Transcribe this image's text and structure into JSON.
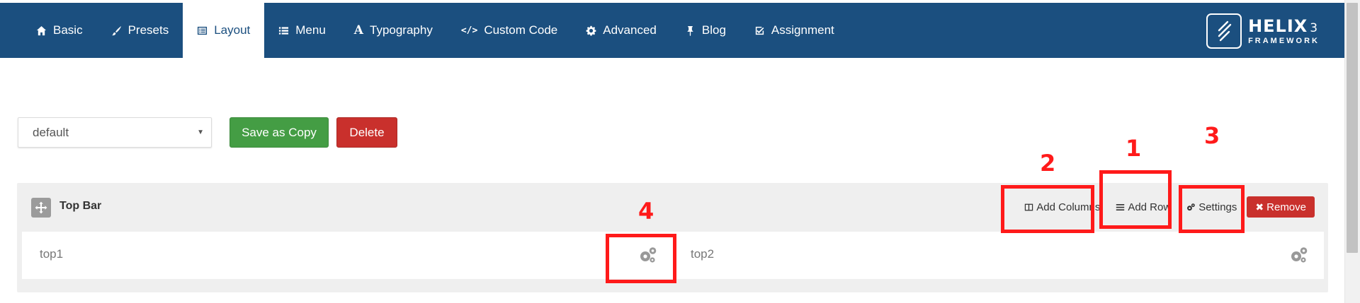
{
  "nav": {
    "tabs": [
      {
        "label": "Basic",
        "icon": "home-icon"
      },
      {
        "label": "Presets",
        "icon": "paint-brush-icon"
      },
      {
        "label": "Layout",
        "icon": "list-alt-icon",
        "active": true
      },
      {
        "label": "Menu",
        "icon": "list-icon"
      },
      {
        "label": "Typography",
        "icon": "font-icon"
      },
      {
        "label": "Custom Code",
        "icon": "code-icon"
      },
      {
        "label": "Advanced",
        "icon": "cog-icon"
      },
      {
        "label": "Blog",
        "icon": "thumbtack-icon"
      },
      {
        "label": "Assignment",
        "icon": "check-square-icon"
      }
    ],
    "brand": {
      "title": "HELIX",
      "number": "3",
      "subtitle": "FRAMEWORK"
    }
  },
  "layout_controls": {
    "selected_layout": "default",
    "save_copy_label": "Save as Copy",
    "delete_label": "Delete"
  },
  "row": {
    "title": "Top Bar",
    "add_columns_label": "Add Columns",
    "add_row_label": "Add Row",
    "settings_label": "Settings",
    "remove_label": "Remove",
    "columns": [
      {
        "name": "top1"
      },
      {
        "name": "top2"
      }
    ]
  },
  "annotations": {
    "add_row": "1",
    "add_columns": "2",
    "settings": "3",
    "column_settings": "4"
  },
  "colors": {
    "nav_bg": "#1b4f7f",
    "save_button": "#449d44",
    "delete_button": "#c9302c",
    "annotation": "#ff1a1a"
  }
}
